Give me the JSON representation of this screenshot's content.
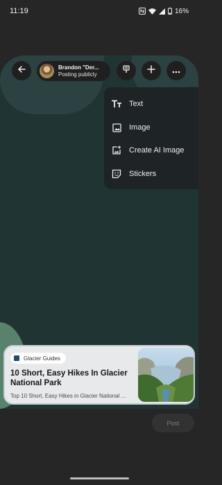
{
  "status_bar": {
    "time": "11:19",
    "battery": "16%",
    "icons": [
      "nfc-icon",
      "wifi-icon",
      "signal-icon",
      "battery-icon"
    ]
  },
  "toolbar": {
    "back_icon": "arrow-left-icon",
    "author": {
      "name": "Brandon \"Der...",
      "visibility": "Posting publicly"
    },
    "icons": [
      "wallpaper-icon",
      "plus-icon",
      "more-horizontal-icon"
    ]
  },
  "add_menu": {
    "items": [
      {
        "label": "Text",
        "icon": "text-format-icon"
      },
      {
        "label": "Image",
        "icon": "image-icon"
      },
      {
        "label": "Create AI Image",
        "icon": "ai-image-icon"
      },
      {
        "label": "Stickers",
        "icon": "sticker-icon"
      }
    ]
  },
  "link_card": {
    "source": "Glacier Guides",
    "title": "10 Short, Easy Hikes In Glacier National Park",
    "description": "Top 10 Short, Easy Hikes in Glacier National ...",
    "thumbnail": "mountain-valley-photo"
  },
  "post_button": {
    "label": "Post",
    "enabled": false
  },
  "colors": {
    "background": "#262626",
    "canvas": "#213434",
    "accent_blob": "#58826c",
    "menu": "#1e2325",
    "card": "#e7e9ea"
  }
}
